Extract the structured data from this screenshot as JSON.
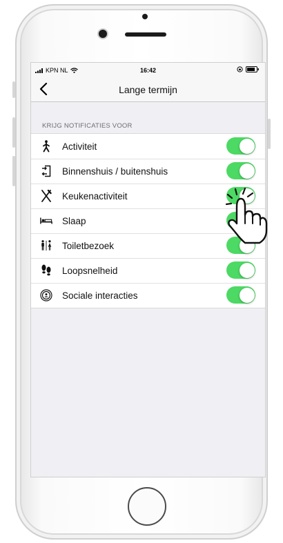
{
  "status_bar": {
    "carrier": "KPN NL",
    "time": "16:42"
  },
  "nav": {
    "back_icon": "chevron-left-icon",
    "title": "Lange termijn"
  },
  "section": {
    "header": "KRIJG NOTIFICATIES VOOR"
  },
  "rows": [
    {
      "icon": "walking-person-icon",
      "label": "Activiteit",
      "enabled": true
    },
    {
      "icon": "door-in-out-icon",
      "label": "Binnenshuis / buitenshuis",
      "enabled": true
    },
    {
      "icon": "fork-knife-icon",
      "label": "Keukenactiviteit",
      "enabled": true
    },
    {
      "icon": "bed-icon",
      "label": "Slaap",
      "enabled": true
    },
    {
      "icon": "toilet-icon",
      "label": "Toiletbezoek",
      "enabled": true
    },
    {
      "icon": "footprints-icon",
      "label": "Loopsnelheid",
      "enabled": true
    },
    {
      "icon": "social-person-icon",
      "label": "Sociale interacties",
      "enabled": true
    }
  ],
  "colors": {
    "toggle_on": "#4cd964",
    "background": "#efeff4"
  }
}
